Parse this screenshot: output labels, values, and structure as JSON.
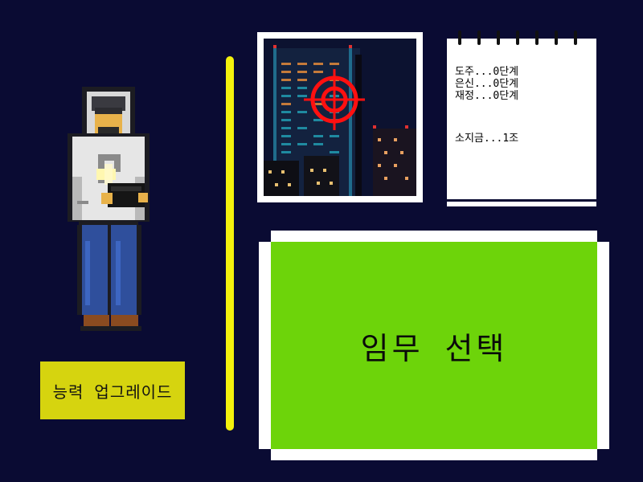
{
  "upgrade_button": {
    "label": "능력 업그레이드"
  },
  "mission_button": {
    "label": "임무 선택"
  },
  "notepad": {
    "stats": [
      {
        "text": "도주...0단계"
      },
      {
        "text": "은신...0단계"
      },
      {
        "text": "재정...0단계"
      }
    ],
    "money": {
      "text": "소지금...1조"
    }
  },
  "colors": {
    "background": "#0a0b33",
    "divider": "#f4f20d",
    "upgrade_button": "#d6d40f",
    "mission_button": "#6dd40a",
    "crosshair": "#ff1010"
  },
  "icons": {
    "character": "hooded-thief-sprite",
    "target": "crosshair-icon"
  }
}
